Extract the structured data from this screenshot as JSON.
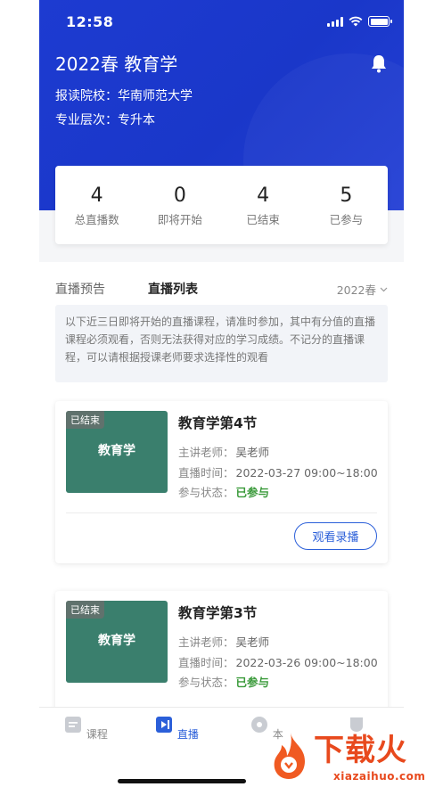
{
  "status_bar": {
    "time": "12:58"
  },
  "header": {
    "title": "2022春 教育学",
    "school_label": "报读院校：",
    "school_value": "华南师范大学",
    "level_label": "专业层次：",
    "level_value": "专升本"
  },
  "stats": [
    {
      "value": "4",
      "label": "总直播数"
    },
    {
      "value": "0",
      "label": "即将开始"
    },
    {
      "value": "4",
      "label": "已结束"
    },
    {
      "value": "5",
      "label": "已参与"
    }
  ],
  "tabs": {
    "preview": "直播预告",
    "list": "直播列表",
    "filter": "2022春"
  },
  "notice": "以下近三日即将开始的直播课程，请准时参加，其中有分值的直播课程必须观看，否则无法获得对应的学习成绩。不记分的直播课程，可以请根据授课老师要求选择性的观看",
  "courses": [
    {
      "badge": "已结束",
      "thumb_text": "教育学",
      "title": "教育学第4节",
      "teacher_label": "主讲老师：",
      "teacher": "吴老师",
      "time_label": "直播时间：",
      "time": "2022-03-27 09:00~18:00",
      "status_label": "参与状态：",
      "status": "已参与",
      "button": "观看录播"
    },
    {
      "badge": "已结束",
      "thumb_text": "教育学",
      "title": "教育学第3节",
      "teacher_label": "主讲老师：",
      "teacher": "吴老师",
      "time_label": "直播时间：",
      "time": "2022-03-26 09:00~18:00",
      "status_label": "参与状态：",
      "status": "已参与"
    }
  ],
  "bottom_nav": [
    {
      "label": "课程",
      "icon": "course-icon"
    },
    {
      "label": "直播",
      "icon": "live-icon",
      "active": true
    },
    {
      "label": "本",
      "icon": "exam-icon"
    },
    {
      "label": "",
      "icon": "profile-icon"
    }
  ],
  "watermark": {
    "main": "下载火",
    "sub": "xiazaihuo.com"
  },
  "colors": {
    "header_blue": "#1d3bd1",
    "accent_blue": "#2b5fd9",
    "thumb_green": "#3a7f6d",
    "status_green": "#3a9a3a",
    "watermark_orange": "#e8491d"
  }
}
